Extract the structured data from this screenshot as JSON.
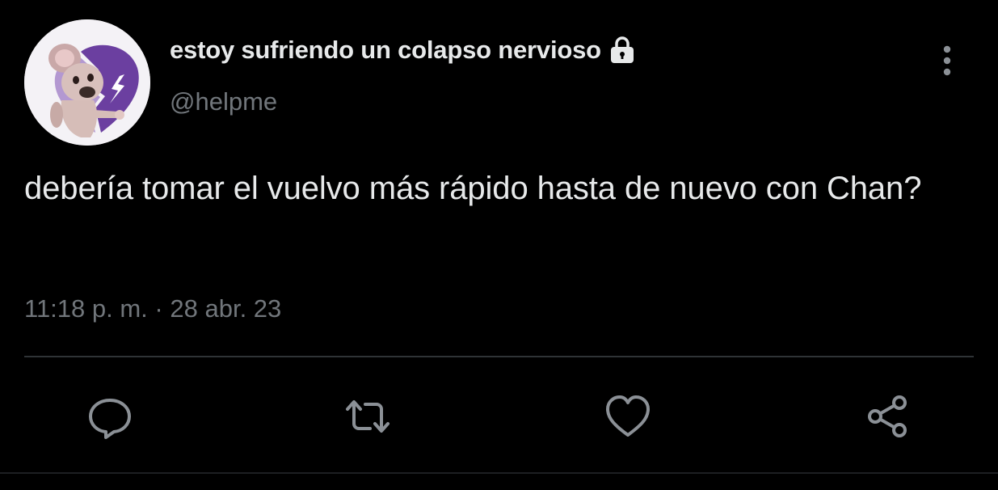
{
  "author": {
    "display_name": "estoy sufriendo un colapso nervioso",
    "handle": "@helpme",
    "protected_icon": "lock-icon",
    "avatar_icon": "avatar-image"
  },
  "tweet": {
    "text": "debería tomar el vuelvo más rápido hasta de nuevo con Chan?",
    "time": "11:18 p. m.",
    "separator": "·",
    "date": "28 abr. 23"
  },
  "actions": {
    "reply_icon": "reply-icon",
    "retweet_icon": "retweet-icon",
    "like_icon": "heart-icon",
    "share_icon": "share-icon",
    "more_icon": "more-vertical-icon"
  },
  "colors": {
    "background": "#000000",
    "text_primary": "#e7e9ea",
    "text_secondary": "#71767b",
    "divider": "#2f3336",
    "avatar_accent": "#6b3fa0"
  }
}
